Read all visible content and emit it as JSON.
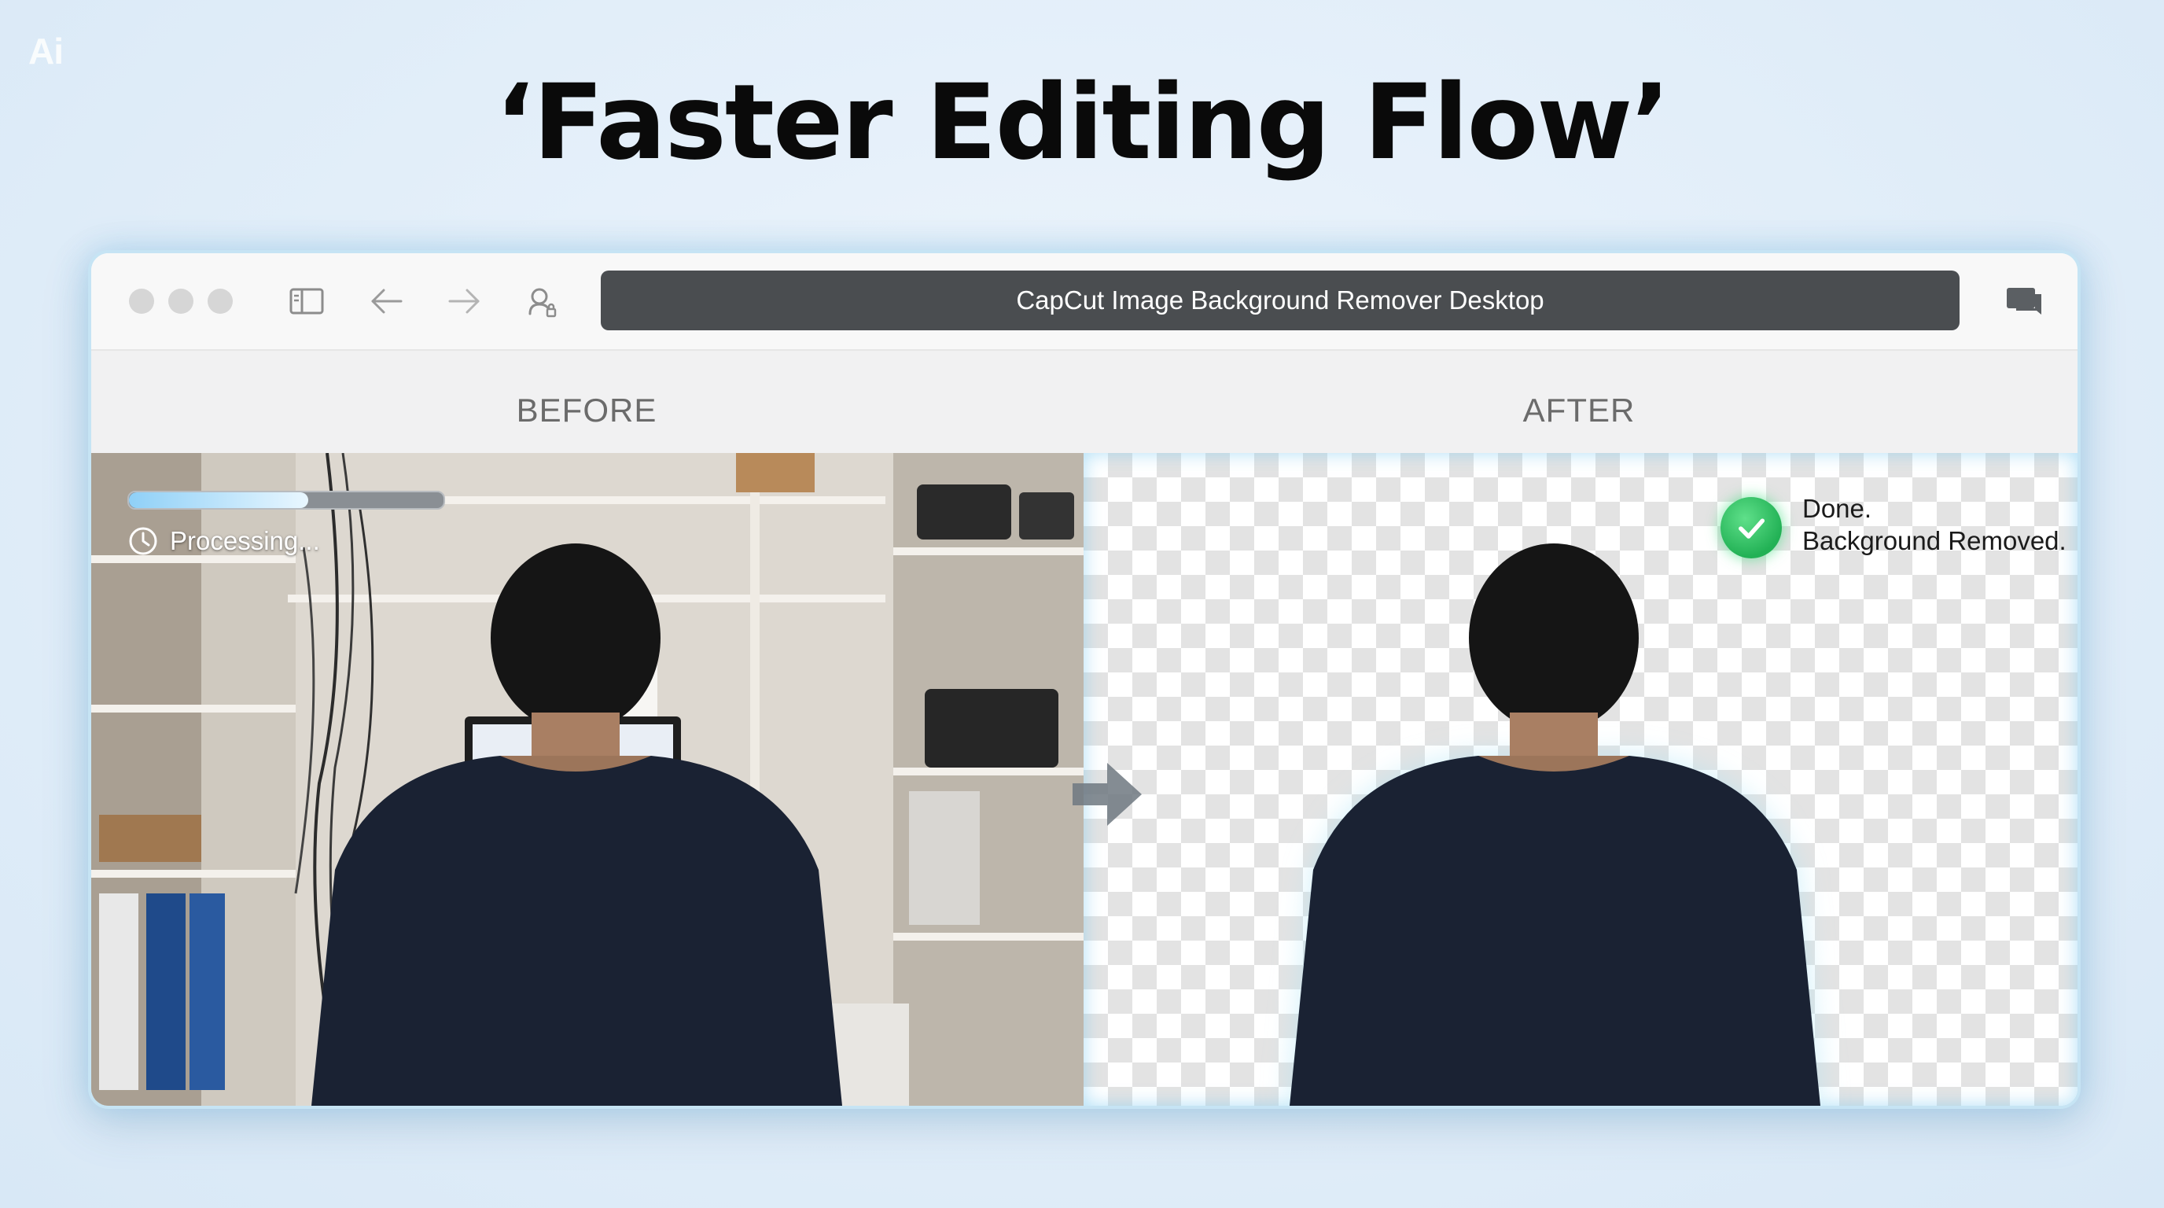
{
  "watermark": {
    "text": "Ai"
  },
  "headline": {
    "text": "‘Faster Editing Flow’"
  },
  "browser": {
    "address_bar": {
      "text": "CapCut Image Background Remover Desktop"
    },
    "icons": [
      "window-dot-icon",
      "sidebar-toggle-icon",
      "back-arrow-icon",
      "forward-arrow-icon",
      "privacy-icon",
      "chat-icon"
    ]
  },
  "comparison": {
    "before_label": "BEFORE",
    "after_label": "AFTER",
    "before_status": "Processing...",
    "progress_fraction": 0.57,
    "after_status_line1": "Done.",
    "after_status_line2": "Background Removed."
  },
  "colors": {
    "address_bar_bg": "#4a4d50",
    "accent_glow": "#c6e4f4",
    "success_green": "#22b155",
    "progress_fill": "#8fd0f7"
  }
}
